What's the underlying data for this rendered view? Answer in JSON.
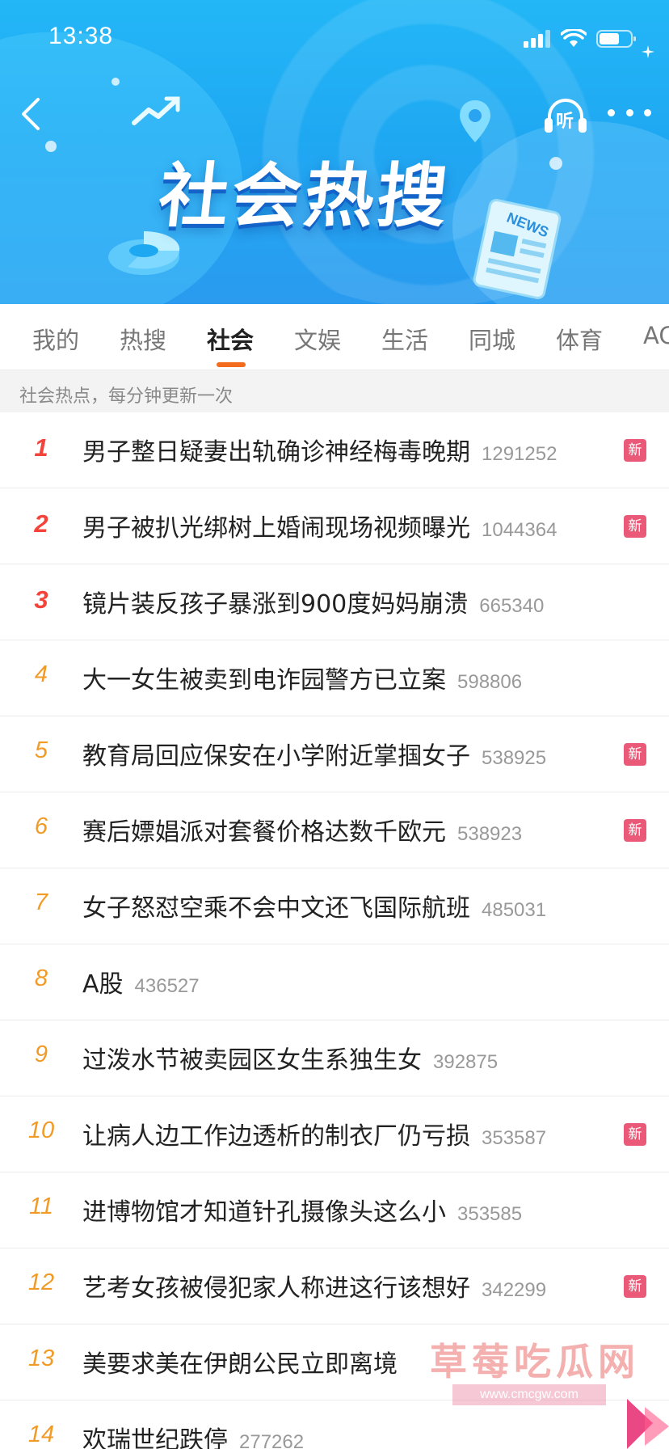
{
  "status_bar": {
    "time": "13:38"
  },
  "header": {
    "title": "社会热搜",
    "listen_label": "听",
    "news_label": "NEWS"
  },
  "tabs": [
    {
      "label": "我的",
      "active": false
    },
    {
      "label": "热搜",
      "active": false
    },
    {
      "label": "社会",
      "active": true
    },
    {
      "label": "文娱",
      "active": false
    },
    {
      "label": "生活",
      "active": false
    },
    {
      "label": "同城",
      "active": false
    },
    {
      "label": "体育",
      "active": false
    },
    {
      "label": "AC",
      "active": false
    }
  ],
  "subheader": "社会热点，每分钟更新一次",
  "badge_label": "新",
  "items": [
    {
      "rank": "1",
      "title": "男子整日疑妻出轨确诊神经梅毒晚期",
      "count": "1291252",
      "new": true
    },
    {
      "rank": "2",
      "title": "男子被扒光绑树上婚闹现场视频曝光",
      "count": "1044364",
      "new": true
    },
    {
      "rank": "3",
      "title": "镜片装反孩子暴涨到900度妈妈崩溃",
      "count": "665340",
      "new": false
    },
    {
      "rank": "4",
      "title": "大一女生被卖到电诈园警方已立案",
      "count": "598806",
      "new": false
    },
    {
      "rank": "5",
      "title": "教育局回应保安在小学附近掌掴女子",
      "count": "538925",
      "new": true
    },
    {
      "rank": "6",
      "title": "赛后嫖娼派对套餐价格达数千欧元",
      "count": "538923",
      "new": true
    },
    {
      "rank": "7",
      "title": "女子怒怼空乘不会中文还飞国际航班",
      "count": "485031",
      "new": false
    },
    {
      "rank": "8",
      "title": "A股",
      "count": "436527",
      "new": false
    },
    {
      "rank": "9",
      "title": "过泼水节被卖园区女生系独生女",
      "count": "392875",
      "new": false
    },
    {
      "rank": "10",
      "title": "让病人边工作边透析的制衣厂仍亏损",
      "count": "353587",
      "new": true
    },
    {
      "rank": "11",
      "title": "进博物馆才知道针孔摄像头这么小",
      "count": "353585",
      "new": false
    },
    {
      "rank": "12",
      "title": "艺考女孩被侵犯家人称进这行该想好",
      "count": "342299",
      "new": true
    },
    {
      "rank": "13",
      "title": "美要求美在伊朗公民立即离境",
      "count": "",
      "new": false
    },
    {
      "rank": "14",
      "title": "欢瑞世纪跌停",
      "count": "277262",
      "new": false
    }
  ],
  "watermark": {
    "text": "草莓吃瓜网",
    "url": "www.cmcgw.com"
  },
  "colors": {
    "accent": "#f36b1c",
    "rank_top": "#f4443a",
    "rank_other": "#f29a26",
    "badge": "#ea5a78",
    "banner": "#1fa8f2"
  }
}
